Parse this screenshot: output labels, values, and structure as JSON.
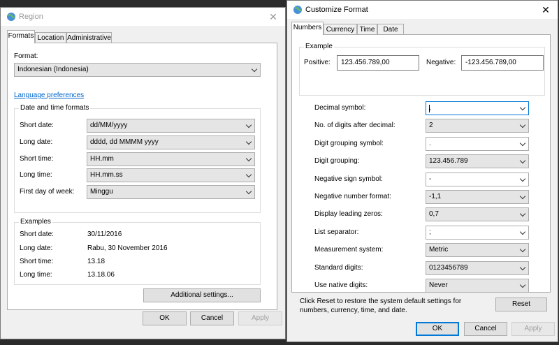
{
  "region": {
    "title": "Region",
    "tabs": [
      "Formats",
      "Location",
      "Administrative"
    ],
    "format_label": "Format:",
    "format_value": "Indonesian (Indonesia)",
    "lang_pref_link": "Language preferences",
    "dt_group_title": "Date and time formats",
    "dt_rows": [
      {
        "label": "Short date:",
        "value": "dd/MM/yyyy"
      },
      {
        "label": "Long date:",
        "value": "dddd, dd MMMM yyyy"
      },
      {
        "label": "Short time:",
        "value": "HH.mm"
      },
      {
        "label": "Long time:",
        "value": "HH.mm.ss"
      },
      {
        "label": "First day of week:",
        "value": "Minggu"
      }
    ],
    "examples_title": "Examples",
    "examples": [
      {
        "label": "Short date:",
        "value": "30/11/2016"
      },
      {
        "label": "Long date:",
        "value": "Rabu, 30 November 2016"
      },
      {
        "label": "Short time:",
        "value": "13.18"
      },
      {
        "label": "Long time:",
        "value": "13.18.06"
      }
    ],
    "additional_settings": "Additional settings...",
    "ok": "OK",
    "cancel": "Cancel",
    "apply": "Apply"
  },
  "customize": {
    "title": "Customize Format",
    "tabs": [
      "Numbers",
      "Currency",
      "Time",
      "Date"
    ],
    "example_title": "Example",
    "positive_label": "Positive:",
    "positive_value": "123.456.789,00",
    "negative_label": "Negative:",
    "negative_value": "-123.456.789,00",
    "rows": [
      {
        "label": "Decimal symbol:",
        "value": ","
      },
      {
        "label": "No. of digits after decimal:",
        "value": "2"
      },
      {
        "label": "Digit grouping symbol:",
        "value": "."
      },
      {
        "label": "Digit grouping:",
        "value": "123.456.789"
      },
      {
        "label": "Negative sign symbol:",
        "value": "-"
      },
      {
        "label": "Negative number format:",
        "value": "-1,1"
      },
      {
        "label": "Display leading zeros:",
        "value": "0,7"
      },
      {
        "label": "List separator:",
        "value": ";"
      },
      {
        "label": "Measurement system:",
        "value": "Metric"
      },
      {
        "label": "Standard digits:",
        "value": "0123456789"
      },
      {
        "label": "Use native digits:",
        "value": "Never"
      }
    ],
    "reset_note": "Click Reset to restore the system default settings for numbers, currency, time, and date.",
    "reset": "Reset",
    "ok": "OK",
    "cancel": "Cancel",
    "apply": "Apply"
  },
  "colors": {
    "accent": "#0078d7",
    "link": "#0066cc"
  }
}
